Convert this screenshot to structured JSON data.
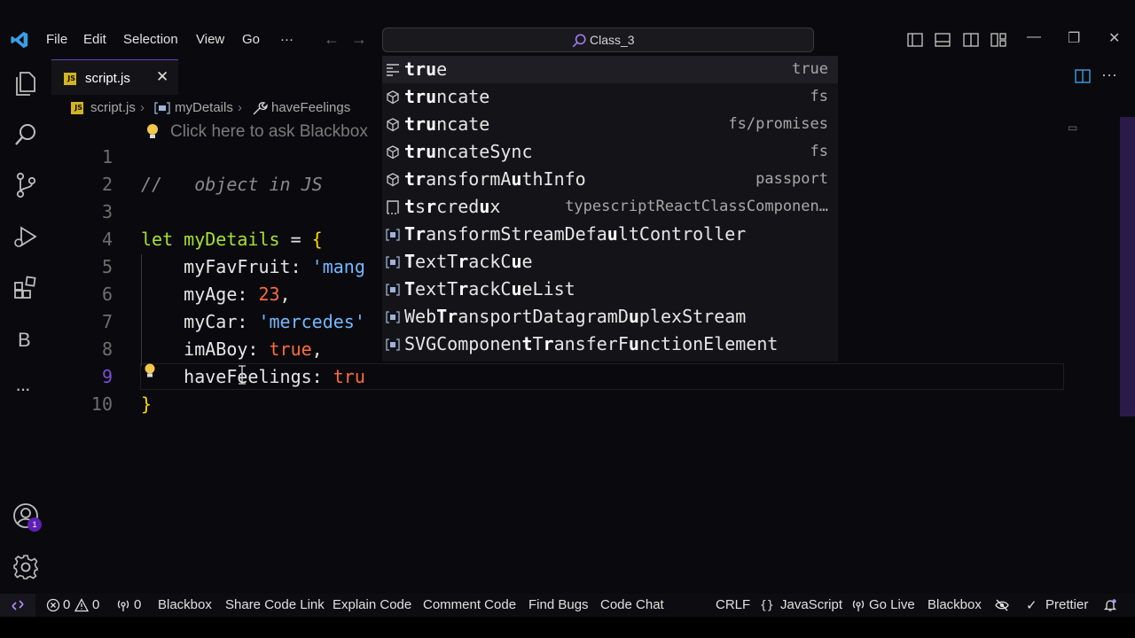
{
  "title_bar": {
    "menus": [
      "File",
      "Edit",
      "Selection",
      "View",
      "Go",
      "···"
    ],
    "command_center_label": "Class_3"
  },
  "tab": {
    "label": "script.js",
    "icon_text": "JS",
    "close": "✕"
  },
  "breadcrumb": {
    "file": "script.js",
    "symbol": "myDetails",
    "property": "haveFeelings"
  },
  "hint": "Click here to ask Blackbox",
  "editor": {
    "active_line": 9,
    "line_numbers": [
      "1",
      "2",
      "3",
      "4",
      "5",
      "6",
      "7",
      "8",
      "9",
      "10"
    ],
    "lines": [
      "",
      "//   object in JS",
      "",
      "let myDetails = {",
      "    myFavFruit: 'mang",
      "    myAge: 23,",
      "    myCar: 'mercedes'",
      "    imABoy: true,",
      "    haveFeelings: tru",
      "}"
    ]
  },
  "suggestions": [
    {
      "kind": "keyword-icon",
      "label": "true",
      "match": 4,
      "detail": "true",
      "selected": true
    },
    {
      "kind": "module-icon",
      "label": "truncate",
      "match": 3,
      "detail": "fs"
    },
    {
      "kind": "module-icon",
      "label": "truncate",
      "match": 3,
      "detail": "fs/promises"
    },
    {
      "kind": "module-icon",
      "label": "truncateSync",
      "match": 3,
      "detail": "fs"
    },
    {
      "kind": "module-icon",
      "label": "transformAuthInfo",
      "match": 2,
      "detail": "passport"
    },
    {
      "kind": "snippet-icon",
      "label": "tsrcredux",
      "match": 0,
      "detail": "typescriptReactClassComponen…"
    },
    {
      "kind": "variable-icon",
      "label": "TransformStreamDefaultController",
      "match": 2,
      "detail": ""
    },
    {
      "kind": "variable-icon",
      "label": "TextTrackCue",
      "match": 0,
      "detail": ""
    },
    {
      "kind": "variable-icon",
      "label": "TextTrackCueList",
      "match": 0,
      "detail": ""
    },
    {
      "kind": "variable-icon",
      "label": "WebTransportDatagramDuplexStream",
      "match": 0,
      "detail": ""
    },
    {
      "kind": "variable-icon",
      "label": "SVGComponentTransferFunctionElement",
      "match": 0,
      "detail": ""
    }
  ],
  "activity_bar": {
    "b_label": "B",
    "more": "···",
    "account_badge": "1"
  },
  "status_bar": {
    "errors": "0",
    "warnings": "0",
    "ports": "0",
    "items_left": [
      "Blackbox",
      "Share Code Link",
      "Explain Code",
      "Comment Code",
      "Find Bugs",
      "Code Chat"
    ],
    "eol": "CRLF",
    "language": "JavaScript",
    "go_live": "Go Live",
    "blackbox": "Blackbox",
    "prettier": "Prettier"
  },
  "colors": {
    "accent": "#6a3ec5",
    "keyword": "#a6e22e",
    "string": "#74b8ff",
    "number": "#ff6a3d",
    "brace": "#ffd700",
    "badge": "#5d1fb5"
  }
}
